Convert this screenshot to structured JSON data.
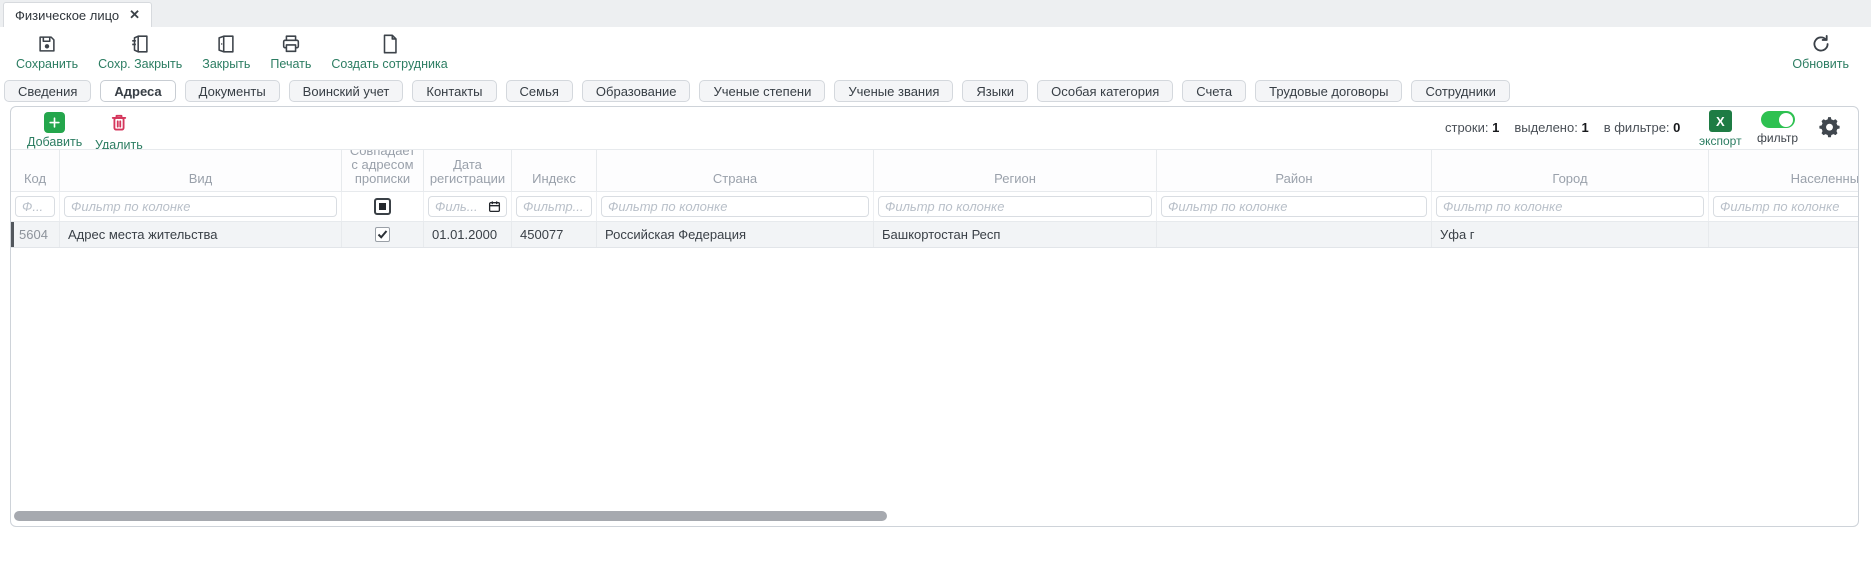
{
  "window_tab": {
    "title": "Физическое лицо",
    "close": "✕"
  },
  "toolbar": {
    "save": "Сохранить",
    "save_close": "Сохр. Закрыть",
    "close": "Закрыть",
    "print": "Печать",
    "create_employee": "Создать сотрудника",
    "refresh": "Обновить"
  },
  "tabs": {
    "items": [
      "Сведения",
      "Адреса",
      "Документы",
      "Воинский учет",
      "Контакты",
      "Семья",
      "Образование",
      "Ученые степени",
      "Ученые звания",
      "Языки",
      "Особая категория",
      "Счета",
      "Трудовые договоры",
      "Сотрудники"
    ],
    "active": "Адреса"
  },
  "grid_toolbar": {
    "add": "Добавить",
    "delete": "Удалить",
    "rows_label": "строки:",
    "rows_value": "1",
    "selected_label": "выделено:",
    "selected_value": "1",
    "in_filter_label": "в фильтре:",
    "in_filter_value": "0",
    "export_label": "экспорт",
    "export_icon_letter": "X",
    "filter_label": "фильтр"
  },
  "table": {
    "headers": {
      "code": "Код",
      "kind": "Вид",
      "matches": "Совпадает с адресом прописки",
      "reg_date": "Дата регистрации",
      "index": "Индекс",
      "country": "Страна",
      "region": "Регион",
      "district": "Район",
      "city": "Город",
      "settlement": "Населенный"
    },
    "filters": {
      "code": "Ф...",
      "kind": "Фильтр по колонке",
      "reg_date": "Филь...",
      "index": "Фильтр...",
      "country": "Фильтр по колонке",
      "region": "Фильтр по колонке",
      "district": "Фильтр по колонке",
      "city": "Фильтр по колонке",
      "settlement": "Фильтр по колонке"
    },
    "row": {
      "code": "5604",
      "kind": "Адрес места жительства",
      "matches_checked": "true",
      "reg_date": "01.01.2000",
      "index": "450077",
      "country": "Российская Федерация",
      "region": "Башкортостан Респ",
      "district": "",
      "city": "Уфа г",
      "settlement": ""
    }
  },
  "colors": {
    "accent_teal": "#2c7d62",
    "add_green": "#24a64c",
    "delete_red": "#d5365c",
    "excel_green": "#1e7c44",
    "toggle_green": "#2ec151",
    "row_bg": "#f2f4f6",
    "header_text": "#9aa1ab"
  }
}
